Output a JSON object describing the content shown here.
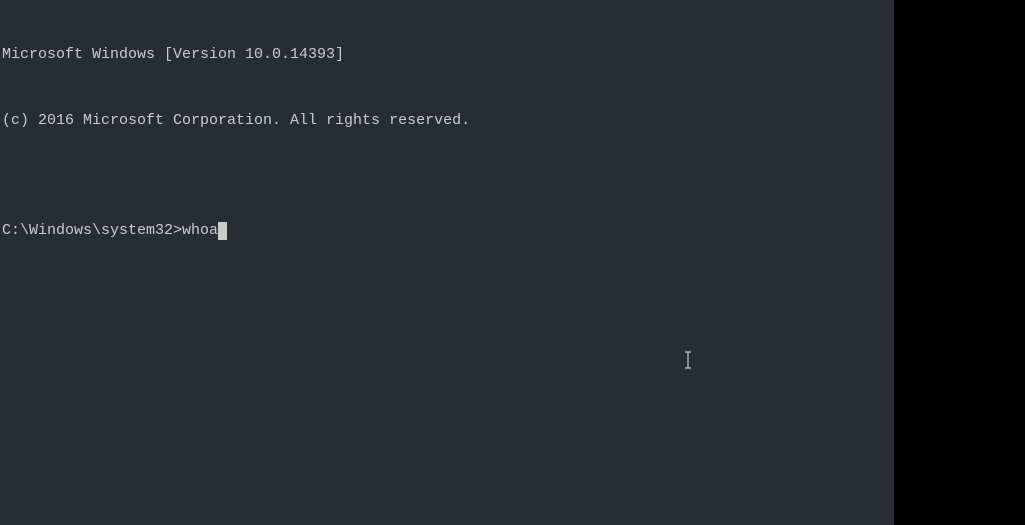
{
  "terminal": {
    "banner_line1": "Microsoft Windows [Version 10.0.14393]",
    "banner_line2": "(c) 2016 Microsoft Corporation. All rights reserved.",
    "blank_line": "",
    "prompt": "C:\\Windows\\system32>",
    "typed_command": "whoa"
  }
}
